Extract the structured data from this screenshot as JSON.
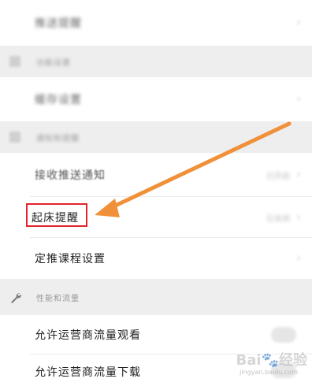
{
  "rows": {
    "top_item": "推送提醒",
    "section1_title": "功能设置",
    "section1_item": "缓存设置",
    "section2_title": "通知和提醒",
    "push_notify": "接收推送通知",
    "push_notify_value": "已开启",
    "wake_reminder": "起床提醒",
    "wake_reminder_value": "已关闭",
    "course_schedule": "定推课程设置",
    "section3_title": "性能和流量",
    "allow_carrier_watch": "允许运营商流量观看",
    "allow_carrier_download": "允许运营商流量下载"
  },
  "icons": {
    "chevron": "›",
    "wrench": "wrench-icon"
  },
  "colors": {
    "highlight": "#e1252a",
    "arrow": "#f0913a"
  },
  "watermark": {
    "text": "Bai🐾经验",
    "sub": "jingyan.baidu.com"
  }
}
